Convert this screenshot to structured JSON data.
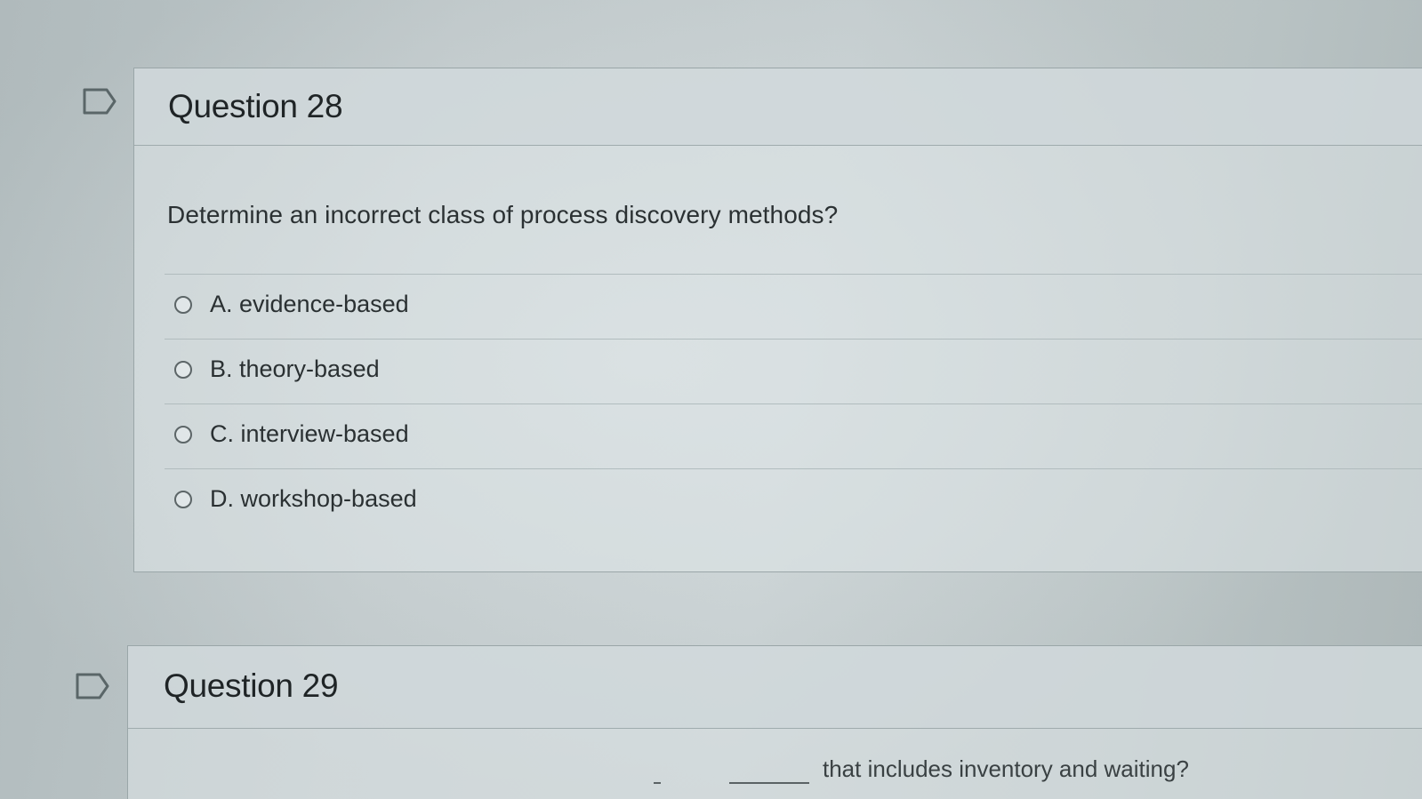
{
  "questions": [
    {
      "title": "Question 28",
      "text": "Determine an incorrect class of process discovery methods?",
      "options": [
        {
          "label": "A. evidence-based",
          "selected": false
        },
        {
          "label": "B. theory-based",
          "selected": false
        },
        {
          "label": "C. interview-based",
          "selected": false
        },
        {
          "label": "D. workshop-based",
          "selected": false
        }
      ]
    },
    {
      "title": "Question 29",
      "text_partial": "that includes inventory and waiting?"
    }
  ],
  "icons": {
    "flag": "flag-question-icon"
  },
  "colors": {
    "text": "#2b3133",
    "border": "#9aa6a8",
    "radio_border": "#5c6567"
  }
}
